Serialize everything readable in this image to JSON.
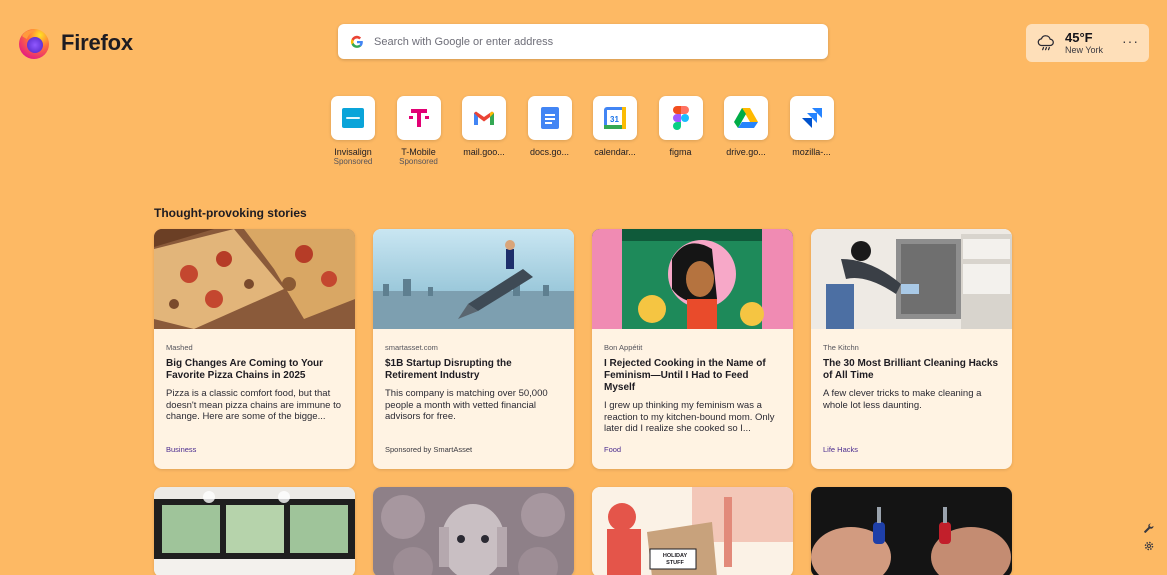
{
  "brand": {
    "name": "Firefox"
  },
  "search": {
    "placeholder": "Search with Google or enter address"
  },
  "weather": {
    "temp": "45°F",
    "city": "New York",
    "menu": "···"
  },
  "top_sites": [
    {
      "label": "Invisalign",
      "sub": "Sponsored",
      "icon": "invisalign-icon"
    },
    {
      "label": "T-Mobile",
      "sub": "Sponsored",
      "icon": "tmobile-icon"
    },
    {
      "label": "mail.goo...",
      "sub": "",
      "icon": "gmail-icon"
    },
    {
      "label": "docs.go...",
      "sub": "",
      "icon": "google-docs-icon"
    },
    {
      "label": "calendar...",
      "sub": "",
      "icon": "google-calendar-icon"
    },
    {
      "label": "figma",
      "sub": "",
      "icon": "figma-icon"
    },
    {
      "label": "drive.go...",
      "sub": "",
      "icon": "google-drive-icon"
    },
    {
      "label": "mozilla-...",
      "sub": "",
      "icon": "jira-icon"
    }
  ],
  "stories": {
    "title": "Thought-provoking stories",
    "cards": [
      {
        "source": "Mashed",
        "title": "Big Changes Are Coming to Your Favorite Pizza Chains in 2025",
        "excerpt": "Pizza is a classic comfort food, but that doesn't mean pizza chains are immune to change. Here are some of the bigge...",
        "tag": "Business"
      },
      {
        "source": "smartasset.com",
        "title": "$1B Startup Disrupting the Retirement Industry",
        "excerpt": "This company is matching over 50,000 people a month with vetted financial advisors for free.",
        "tag": "Sponsored by SmartAsset"
      },
      {
        "source": "Bon Appétit",
        "title": "I Rejected Cooking in the Name of Feminism—Until I Had to Feed Myself",
        "excerpt": "I grew up thinking my feminism was a reaction to my kitchen-bound mom. Only later did I realize she cooked so I...",
        "tag": "Food"
      },
      {
        "source": "The Kitchn",
        "title": "The 30 Most Brilliant Cleaning Hacks of All Time",
        "excerpt": "A few clever tricks to make cleaning a whole lot less daunting.",
        "tag": "Life Hacks"
      }
    ],
    "box_label": "HOLIDAY STUFF"
  },
  "colors": {
    "background": "#fdb964",
    "card": "#fff3e3",
    "category": "#4a2b8f"
  }
}
